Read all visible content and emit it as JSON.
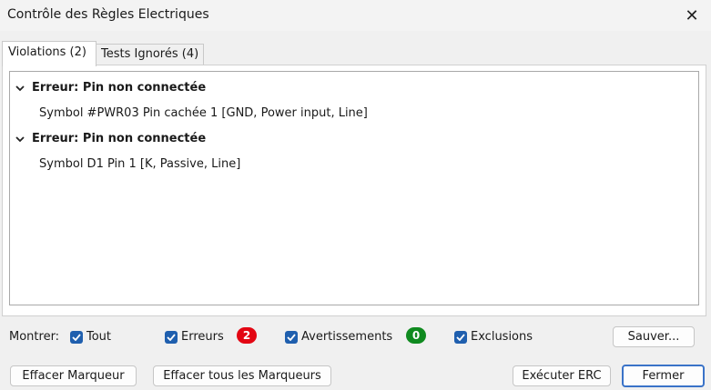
{
  "window": {
    "title": "Contrôle des Règles Electriques"
  },
  "tabs": [
    {
      "label": "Violations (2)",
      "active": true
    },
    {
      "label": "Tests Ignorés (4)",
      "active": false
    }
  ],
  "violations": [
    {
      "category": "Erreur: Pin non connectée",
      "item": "Symbol #PWR03 Pin cachée 1 [GND, Power input, Line]"
    },
    {
      "category": "Erreur: Pin non connectée",
      "item": "Symbol D1 Pin 1 [K, Passive, Line]"
    }
  ],
  "filters": {
    "show_label": "Montrer:",
    "all": "Tout",
    "errors": "Erreurs",
    "errors_count": "2",
    "warnings": "Avertissements",
    "warnings_count": "0",
    "exclusions": "Exclusions"
  },
  "buttons": {
    "save": "Sauver...",
    "clear_marker": "Effacer Marqueur",
    "clear_all_markers": "Effacer tous les Marqueurs",
    "run_erc": "Exécuter ERC",
    "close": "Fermer"
  },
  "colors": {
    "error_badge": "#e30613",
    "warning_badge": "#0f8a1f",
    "checkbox": "#1f5fae"
  },
  "icons": {
    "close": "close-icon",
    "expand": "chevron-down-icon",
    "check": "checkmark-icon"
  }
}
